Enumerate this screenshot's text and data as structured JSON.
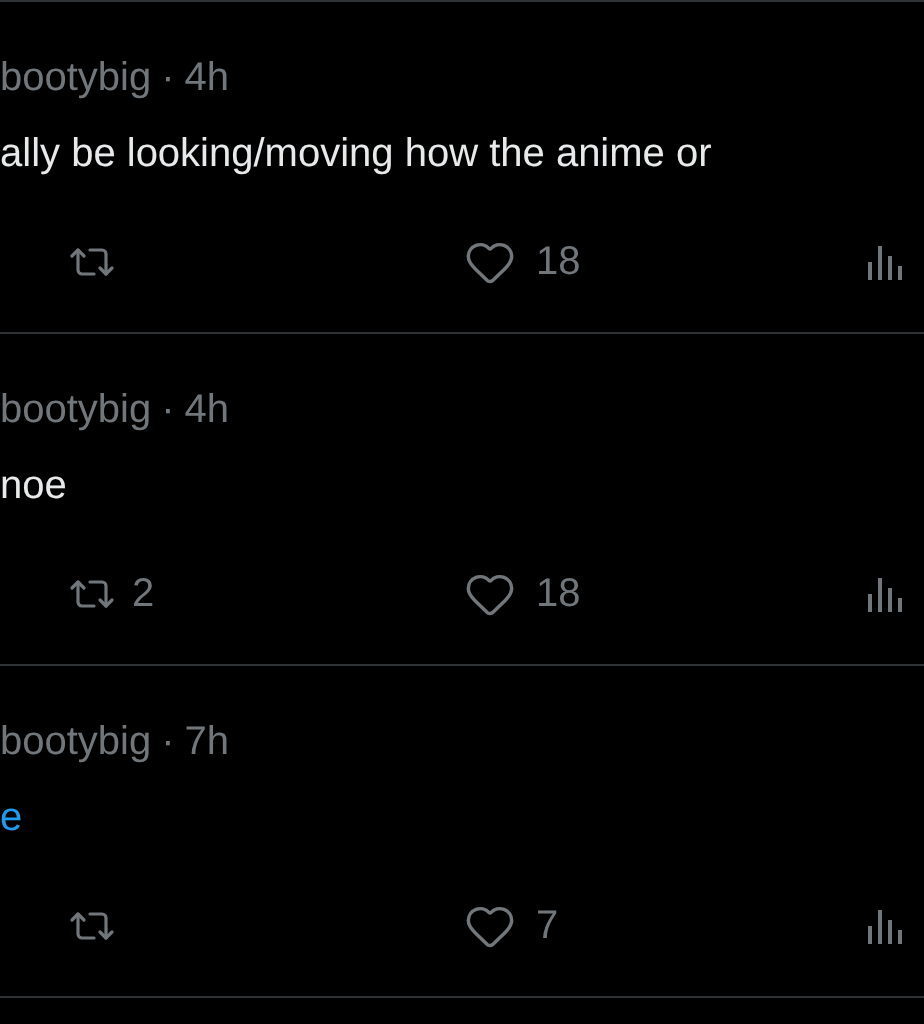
{
  "tweets": [
    {
      "handle": "bootybig",
      "separator": "·",
      "time": "4h",
      "body": {
        "kind": "text",
        "text": "ally be looking/moving how the anime or"
      },
      "likes": "18"
    },
    {
      "handle": "bootybig",
      "separator": "·",
      "time": "4h",
      "body": {
        "kind": "text",
        "text": "noe"
      },
      "retweets": "2",
      "likes": "18"
    },
    {
      "handle": "bootybig",
      "separator": "·",
      "time": "7h",
      "body": {
        "kind": "link",
        "text": "e"
      },
      "likes": "7"
    }
  ]
}
